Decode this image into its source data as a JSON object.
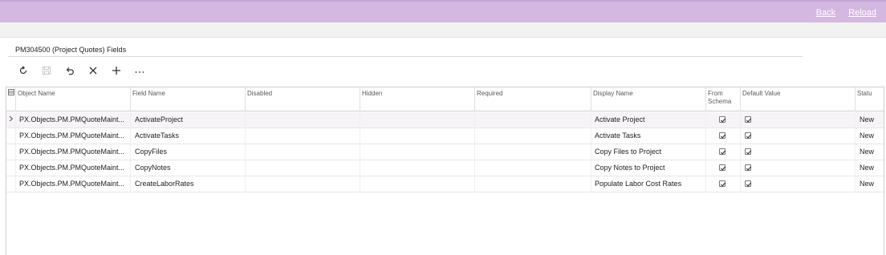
{
  "header": {
    "back_label": "Back",
    "reload_label": "Reload"
  },
  "page": {
    "title": "PM304500 (Project Quotes) Fields"
  },
  "toolbar": {
    "buttons": [
      {
        "name": "refresh-button",
        "icon": "refresh-icon"
      },
      {
        "name": "save-button",
        "icon": "save-icon"
      },
      {
        "name": "undo-button",
        "icon": "undo-icon"
      },
      {
        "name": "delete-button",
        "icon": "close-icon"
      },
      {
        "name": "add-row-button",
        "icon": "plus-icon"
      },
      {
        "name": "more-button",
        "icon": "ellipsis-icon"
      }
    ]
  },
  "grid": {
    "columns": {
      "object_name": "Object Name",
      "field_name": "Field Name",
      "disabled": "Disabled",
      "hidden": "Hidden",
      "required": "Required",
      "display_name": "Display Name",
      "from_schema": "From Schema",
      "default_value": "Default Value",
      "status": "Statu"
    },
    "rows": [
      {
        "object_name": "PX.Objects.PM.PMQuoteMaint...",
        "field_name": "ActivateProject",
        "display_name": "Activate Project",
        "from_schema": true,
        "default_value": true,
        "status": "New",
        "selected": true
      },
      {
        "object_name": "PX.Objects.PM.PMQuoteMaint...",
        "field_name": "ActivateTasks",
        "display_name": "Activate Tasks",
        "from_schema": true,
        "default_value": true,
        "status": "New",
        "selected": false
      },
      {
        "object_name": "PX.Objects.PM.PMQuoteMaint...",
        "field_name": "CopyFiles",
        "display_name": "Copy Files to Project",
        "from_schema": true,
        "default_value": true,
        "status": "New",
        "selected": false
      },
      {
        "object_name": "PX.Objects.PM.PMQuoteMaint...",
        "field_name": "CopyNotes",
        "display_name": "Copy Notes to Project",
        "from_schema": true,
        "default_value": true,
        "status": "New",
        "selected": false
      },
      {
        "object_name": "PX.Objects.PM.PMQuoteMaint...",
        "field_name": "CreateLaborRates",
        "display_name": "Populate Labor Cost Rates",
        "from_schema": true,
        "default_value": true,
        "status": "New",
        "selected": false
      }
    ]
  },
  "colors": {
    "topbar": "#d4b8e1",
    "subbar": "#f2f2f2",
    "selected_row": "#f7f4f8"
  }
}
